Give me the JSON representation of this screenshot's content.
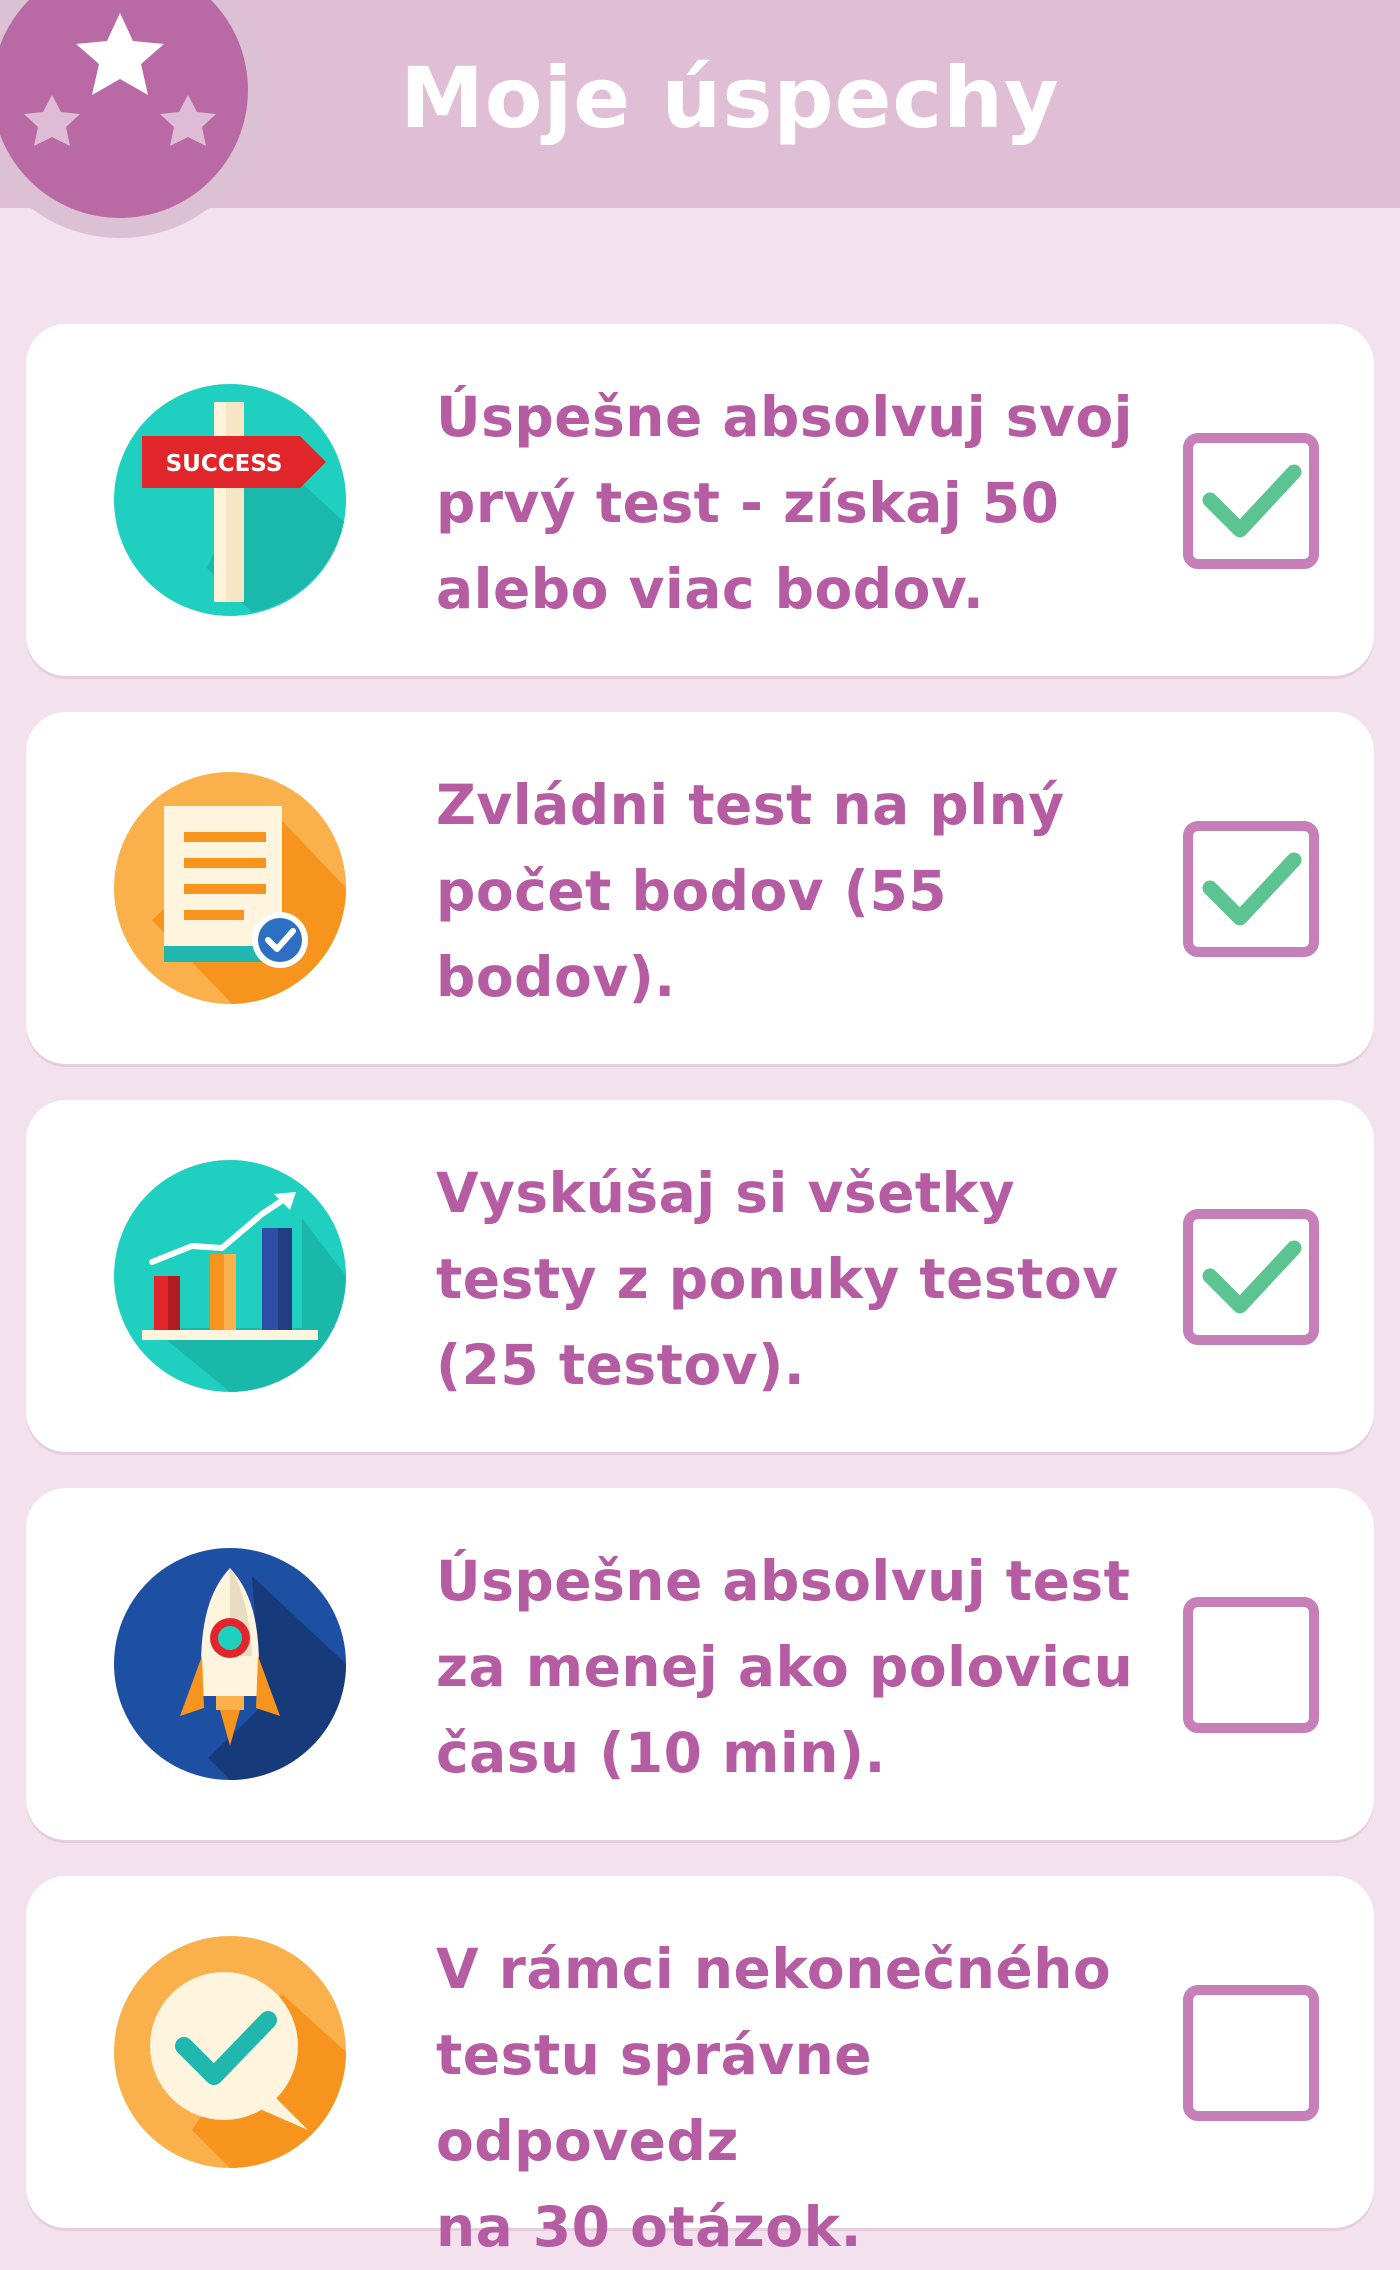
{
  "header": {
    "title": "Moje úspechy"
  },
  "badge_icon": "stars-badge-icon",
  "colors": {
    "background": "#f3e2ee",
    "header": "#e0bfd6",
    "text": "#b65ca2",
    "checkbox_border": "#c67fb8",
    "check": "#5cc490"
  },
  "achievements": [
    {
      "icon": "success-signpost-icon",
      "text": "Úspešne absolvuj svoj\nprvý test - získaj 50\nalebo viac bodov.",
      "checked": true
    },
    {
      "icon": "document-check-icon",
      "text": "Zvládni test na plný\npočet bodov (55\nbodov).",
      "checked": true
    },
    {
      "icon": "growth-chart-icon",
      "text": "Vyskúšaj si všetky\ntesty z ponuky testov\n(25 testov).",
      "checked": true
    },
    {
      "icon": "rocket-icon",
      "text": "Úspešne absolvuj test\nza menej ako polovicu\nčasu (10 min).",
      "checked": false
    },
    {
      "icon": "speech-bubble-check-icon",
      "text": "V rámci nekonečného\ntestu správne odpovedz\nna 30 otázok.",
      "checked": false
    }
  ]
}
